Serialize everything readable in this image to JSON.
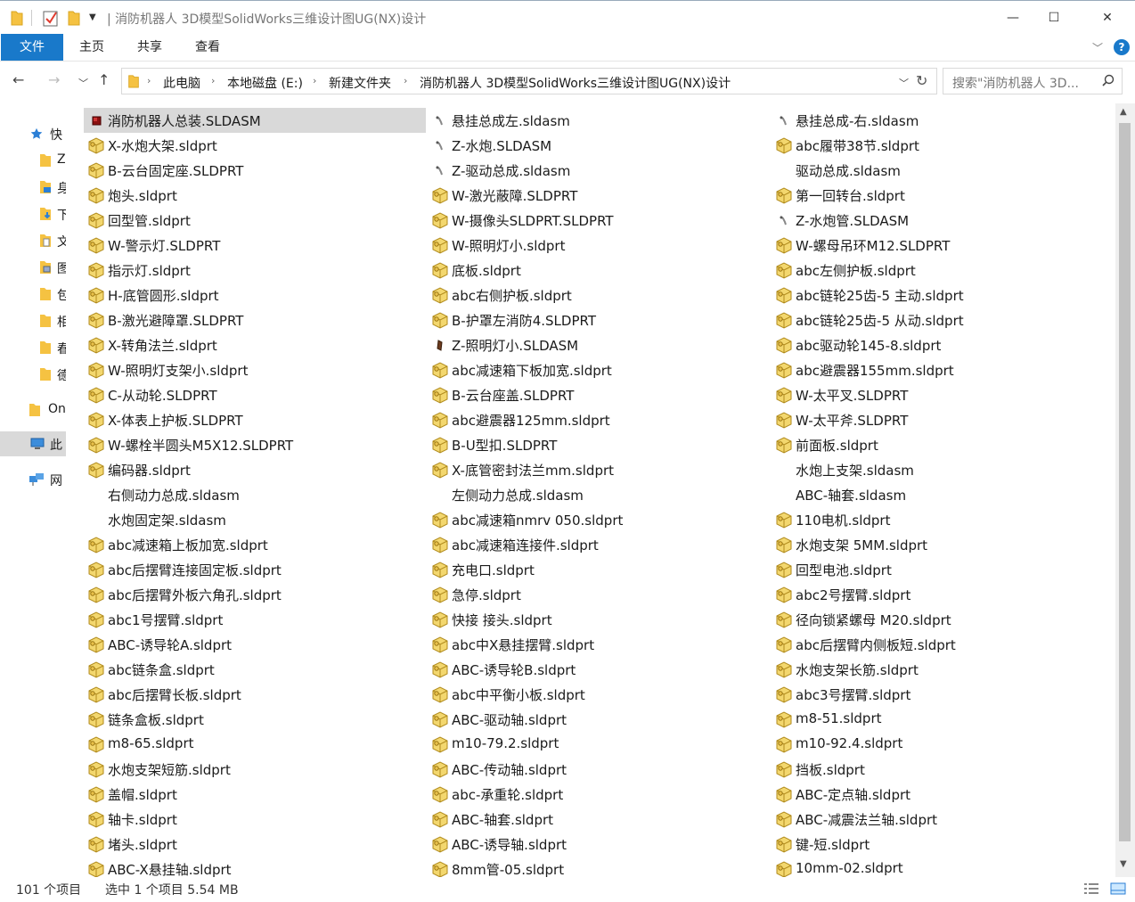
{
  "window": {
    "title": "| 消防机器人 3D模型SolidWorks三维设计图UG(NX)设计",
    "min_glyph": "—",
    "max_glyph": "☐",
    "close_glyph": "✕"
  },
  "ribbon": {
    "tabs": [
      "文件",
      "主页",
      "共享",
      "查看"
    ],
    "expand_glyph": "﹀",
    "help_glyph": "?"
  },
  "nav": {
    "back_glyph": "←",
    "forward_glyph": "→",
    "recent_glyph": "﹀",
    "up_glyph": "↑"
  },
  "address": {
    "crumbs": [
      "此电脑",
      "本地磁盘 (E:)",
      "新建文件夹",
      "消防机器人 3D模型SolidWorks三维设计图UG(NX)设计"
    ],
    "sep_glyph": "›",
    "dropdown_glyph": "﹀",
    "refresh_glyph": "↻"
  },
  "search": {
    "placeholder": "搜索\"消防机器人 3D..."
  },
  "sidebar": {
    "items": [
      {
        "label": "快",
        "icon": "star-icon"
      },
      {
        "label": "Z",
        "icon": "folder-icon"
      },
      {
        "label": "身",
        "icon": "desktop-folder-icon"
      },
      {
        "label": "下",
        "icon": "download-folder-icon"
      },
      {
        "label": "文",
        "icon": "documents-folder-icon"
      },
      {
        "label": "图",
        "icon": "pictures-folder-icon"
      },
      {
        "label": "包",
        "icon": "folder-icon"
      },
      {
        "label": "相",
        "icon": "folder-icon"
      },
      {
        "label": "春",
        "icon": "folder-icon"
      },
      {
        "label": "德",
        "icon": "folder-icon"
      },
      {
        "label": "On",
        "icon": "folder-icon"
      },
      {
        "label": "此",
        "icon": "computer-icon"
      },
      {
        "label": "网",
        "icon": "network-icon"
      }
    ]
  },
  "files": {
    "col0": [
      {
        "name": "消防机器人总装.SLDASM",
        "icon": "assembly"
      },
      {
        "name": "X-水炮大架.sldprt",
        "icon": "part"
      },
      {
        "name": "B-云台固定座.SLDPRT",
        "icon": "part"
      },
      {
        "name": "炮头.sldprt",
        "icon": "part"
      },
      {
        "name": "回型管.sldprt",
        "icon": "part"
      },
      {
        "name": "W-警示灯.SLDPRT",
        "icon": "part"
      },
      {
        "name": "指示灯.sldprt",
        "icon": "part"
      },
      {
        "name": "H-底管圆形.sldprt",
        "icon": "part"
      },
      {
        "name": "B-激光避障罩.SLDPRT",
        "icon": "part"
      },
      {
        "name": "X-转角法兰.sldprt",
        "icon": "part"
      },
      {
        "name": "W-照明灯支架小.sldprt",
        "icon": "part"
      },
      {
        "name": "C-从动轮.SLDPRT",
        "icon": "part"
      },
      {
        "name": "X-体表上护板.SLDPRT",
        "icon": "part"
      },
      {
        "name": "W-螺栓半圆头M5X12.SLDPRT",
        "icon": "part"
      },
      {
        "name": "编码器.sldprt",
        "icon": "part"
      },
      {
        "name": "右侧动力总成.sldasm",
        "icon": "none"
      },
      {
        "name": "水炮固定架.sldasm",
        "icon": "none"
      },
      {
        "name": "abc减速箱上板加宽.sldprt",
        "icon": "part"
      },
      {
        "name": "abc后摆臂连接固定板.sldprt",
        "icon": "part"
      },
      {
        "name": "abc后摆臂外板六角孔.sldprt",
        "icon": "part"
      },
      {
        "name": "abc1号摆臂.sldprt",
        "icon": "part"
      },
      {
        "name": "ABC-诱导轮A.sldprt",
        "icon": "part"
      },
      {
        "name": "abc链条盒.sldprt",
        "icon": "part"
      },
      {
        "name": "abc后摆臂长板.sldprt",
        "icon": "part"
      },
      {
        "name": "链条盒板.sldprt",
        "icon": "part"
      },
      {
        "name": "m8-65.sldprt",
        "icon": "part"
      },
      {
        "name": "水炮支架短筋.sldprt",
        "icon": "part"
      },
      {
        "name": "盖帽.sldprt",
        "icon": "part"
      },
      {
        "name": "轴卡.sldprt",
        "icon": "part"
      },
      {
        "name": "堵头.sldprt",
        "icon": "part"
      },
      {
        "name": "ABC-X悬挂轴.sldprt",
        "icon": "part"
      }
    ],
    "col1": [
      {
        "name": "悬挂总成左.sldasm",
        "icon": "asm-small"
      },
      {
        "name": "Z-水炮.SLDASM",
        "icon": "asm-small"
      },
      {
        "name": "Z-驱动总成.sldasm",
        "icon": "asm-small"
      },
      {
        "name": "W-激光蔽障.SLDPRT",
        "icon": "part"
      },
      {
        "name": "W-摄像头SLDPRT.SLDPRT",
        "icon": "part"
      },
      {
        "name": "W-照明灯小.sldprt",
        "icon": "part"
      },
      {
        "name": "底板.sldprt",
        "icon": "part"
      },
      {
        "name": "abc右侧护板.sldprt",
        "icon": "part"
      },
      {
        "name": "B-护罩左消防4.SLDPRT",
        "icon": "part"
      },
      {
        "name": "Z-照明灯小.SLDASM",
        "icon": "asm-dark"
      },
      {
        "name": "abc减速箱下板加宽.sldprt",
        "icon": "part"
      },
      {
        "name": "B-云台座盖.SLDPRT",
        "icon": "part"
      },
      {
        "name": "abc避震器125mm.sldprt",
        "icon": "part"
      },
      {
        "name": "B-U型扣.SLDPRT",
        "icon": "part"
      },
      {
        "name": "X-底管密封法兰mm.sldprt",
        "icon": "part"
      },
      {
        "name": "左侧动力总成.sldasm",
        "icon": "none"
      },
      {
        "name": "abc减速箱nmrv 050.sldprt",
        "icon": "part"
      },
      {
        "name": "abc减速箱连接件.sldprt",
        "icon": "part"
      },
      {
        "name": "充电口.sldprt",
        "icon": "part"
      },
      {
        "name": "急停.sldprt",
        "icon": "part"
      },
      {
        "name": "快接 接头.sldprt",
        "icon": "part"
      },
      {
        "name": "abc中X悬挂摆臂.sldprt",
        "icon": "part"
      },
      {
        "name": "ABC-诱导轮B.sldprt",
        "icon": "part"
      },
      {
        "name": "abc中平衡小板.sldprt",
        "icon": "part"
      },
      {
        "name": "ABC-驱动轴.sldprt",
        "icon": "part"
      },
      {
        "name": "m10-79.2.sldprt",
        "icon": "part"
      },
      {
        "name": "ABC-传动轴.sldprt",
        "icon": "part"
      },
      {
        "name": "abc-承重轮.sldprt",
        "icon": "part"
      },
      {
        "name": "ABC-轴套.sldprt",
        "icon": "part"
      },
      {
        "name": "ABC-诱导轴.sldprt",
        "icon": "part"
      },
      {
        "name": "8mm管-05.sldprt",
        "icon": "part"
      }
    ],
    "col2": [
      {
        "name": "悬挂总成-右.sldasm",
        "icon": "asm-small"
      },
      {
        "name": "abc履带38节.sldprt",
        "icon": "part"
      },
      {
        "name": "驱动总成.sldasm",
        "icon": "none"
      },
      {
        "name": "第一回转台.sldprt",
        "icon": "part"
      },
      {
        "name": "Z-水炮管.SLDASM",
        "icon": "asm-small"
      },
      {
        "name": "W-螺母吊环M12.SLDPRT",
        "icon": "part"
      },
      {
        "name": "abc左侧护板.sldprt",
        "icon": "part"
      },
      {
        "name": "abc链轮25齿-5 主动.sldprt",
        "icon": "part"
      },
      {
        "name": "abc链轮25齿-5 从动.sldprt",
        "icon": "part"
      },
      {
        "name": "abc驱动轮145-8.sldprt",
        "icon": "part"
      },
      {
        "name": "abc避震器155mm.sldprt",
        "icon": "part"
      },
      {
        "name": "W-太平叉.SLDPRT",
        "icon": "part"
      },
      {
        "name": "W-太平斧.SLDPRT",
        "icon": "part"
      },
      {
        "name": "前面板.sldprt",
        "icon": "part"
      },
      {
        "name": "水炮上支架.sldasm",
        "icon": "none"
      },
      {
        "name": "ABC-轴套.sldasm",
        "icon": "none"
      },
      {
        "name": "110电机.sldprt",
        "icon": "part"
      },
      {
        "name": "水炮支架 5MM.sldprt",
        "icon": "part"
      },
      {
        "name": "回型电池.sldprt",
        "icon": "part"
      },
      {
        "name": "abc2号摆臂.sldprt",
        "icon": "part"
      },
      {
        "name": "径向锁紧螺母 M20.sldprt",
        "icon": "part"
      },
      {
        "name": "abc后摆臂内侧板短.sldprt",
        "icon": "part"
      },
      {
        "name": "水炮支架长筋.sldprt",
        "icon": "part"
      },
      {
        "name": "abc3号摆臂.sldprt",
        "icon": "part"
      },
      {
        "name": "m8-51.sldprt",
        "icon": "part"
      },
      {
        "name": "m10-92.4.sldprt",
        "icon": "part"
      },
      {
        "name": "挡板.sldprt",
        "icon": "part"
      },
      {
        "name": "ABC-定点轴.sldprt",
        "icon": "part"
      },
      {
        "name": "ABC-减震法兰轴.sldprt",
        "icon": "part"
      },
      {
        "name": "键-短.sldprt",
        "icon": "part"
      },
      {
        "name": "10mm-02.sldprt",
        "icon": "part"
      }
    ]
  },
  "status": {
    "count": "101 个项目",
    "selected": "选中 1 个项目  5.54 MB"
  },
  "colors": {
    "accent": "#1979ca",
    "selection": "#d9d9d9",
    "folder": "#f5c242"
  }
}
